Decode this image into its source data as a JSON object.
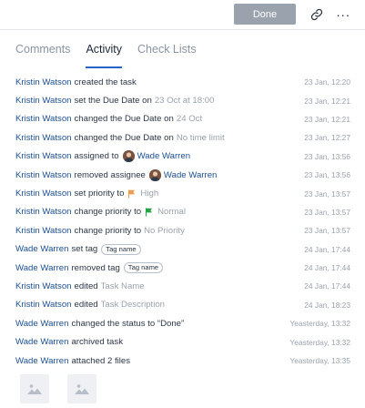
{
  "toolbar": {
    "done_label": "Done",
    "link_icon": "link-icon",
    "more_label": "···"
  },
  "tabs": [
    {
      "label": "Comments",
      "active": false
    },
    {
      "label": "Activity",
      "active": true
    },
    {
      "label": "Check Lists",
      "active": false
    }
  ],
  "activity": [
    {
      "user": "Kristin Watson",
      "action": "created the task",
      "time": "23 Jan, 12:20"
    },
    {
      "user": "Kristin Watson",
      "action": "set the Due Date on",
      "detail": "23 Oct at 18:00",
      "time": "23 Jan, 12:21"
    },
    {
      "user": "Kristin Watson",
      "action": "changed the Due Date on",
      "detail": "24 Oct",
      "time": "23 Jan, 12:21"
    },
    {
      "user": "Kristin Watson",
      "action": "changed the Due Date on",
      "detail": "No time limit",
      "time": "23 Jan, 12:27"
    },
    {
      "user": "Kristin Watson",
      "action": "assigned to",
      "assignee": "Wade Warren",
      "time": "23 Jan, 13:56"
    },
    {
      "user": "Kristin Watson",
      "action": "removed assignee",
      "assignee": "Wade Warren",
      "time": "23 Jan, 13:56"
    },
    {
      "user": "Kristin Watson",
      "action": "set priority to",
      "priority": "High",
      "priority_color": "#f2994a",
      "time": "23 Jan, 13:57"
    },
    {
      "user": "Kristin Watson",
      "action": "change priority to",
      "priority": "Normal",
      "priority_color": "#22a447",
      "time": "23 Jan, 13:57"
    },
    {
      "user": "Kristin Watson",
      "action": "change priority to",
      "detail": "No Priority",
      "time": "23 Jan, 13:57"
    },
    {
      "user": "Wade Warren",
      "action": "set tag",
      "tag": "Tag name",
      "time": "24 Jan, 17:44"
    },
    {
      "user": "Wade Warren",
      "action": "removed tag",
      "tag": "Tag name",
      "time": "24 Jan, 17:44"
    },
    {
      "user": "Kristin Watson",
      "action": "edited",
      "detail": "Task Name",
      "time": "24 Jan, 17:44"
    },
    {
      "user": "Kristin Watson",
      "action": "edited",
      "detail": "Task Description",
      "time": "24 Jan, 18:23"
    },
    {
      "user": "Wade Warren",
      "action": "changed the status to “Done”",
      "time": "Yeasterday, 13:32"
    },
    {
      "user": "Wade Warren",
      "action": "archived task",
      "time": "Yeasterday, 13:32"
    },
    {
      "user": "Wade Warren",
      "action": "attached 2 files",
      "time": "Yeasterday, 13:35"
    }
  ],
  "attachments": [
    {
      "icon": "image-placeholder-icon"
    },
    {
      "icon": "image-placeholder-icon"
    }
  ],
  "colors": {
    "user_link": "#1d4f91",
    "muted": "#9aa3ad",
    "tab_underline": "#2563c9",
    "done_button": "#9aa3ad"
  }
}
